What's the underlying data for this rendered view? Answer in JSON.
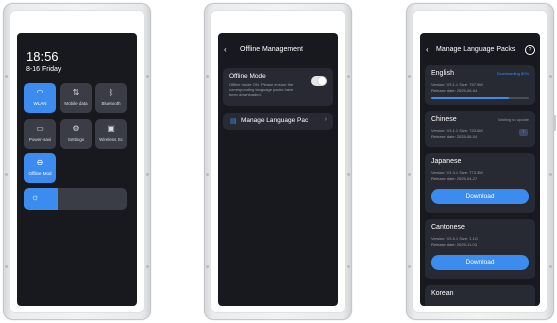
{
  "screen1": {
    "time": "18:56",
    "date": "8-16 Friday",
    "tiles": [
      {
        "label": "WLAN",
        "icon": "wifi-icon",
        "active": true
      },
      {
        "label": "Mobile data",
        "icon": "mobile-data-icon",
        "active": false
      },
      {
        "label": "Bluetooth",
        "icon": "bluetooth-icon",
        "active": false
      },
      {
        "label": "Power-savi",
        "icon": "power-saving-icon",
        "active": false
      },
      {
        "label": "Settings",
        "icon": "settings-icon",
        "active": false
      },
      {
        "label": "Wireless Sc",
        "icon": "wireless-screen-icon",
        "active": false
      },
      {
        "label": "Offline Mod",
        "icon": "offline-mode-icon",
        "active": true
      }
    ],
    "brightness": 0.33
  },
  "screen2": {
    "title": "Offline Management",
    "offline_mode": {
      "label": "Offline Mode",
      "description": "Offline mode ON. Please ensure the corresponding language packs have been downloaded.",
      "enabled": true
    },
    "manage_label": "Manage Language Pac"
  },
  "screen3": {
    "title": "Manage Language Packs",
    "packs": [
      {
        "name": "English",
        "version": "Version: V3.1.1 Size: 757.9M",
        "release": "Release date: 2025-06-04",
        "status": "Downloading 80%",
        "progress": 0.8
      },
      {
        "name": "Chinese",
        "version": "Version: V3.1.1 Size: 723.0M",
        "release": "Release date: 2025-06-04",
        "status": "Waiting to update"
      },
      {
        "name": "Japanese",
        "version": "Version: V1.3.1 Size: 773.3M",
        "release": "Release date: 2025-04-27",
        "button": "Download"
      },
      {
        "name": "Cantonese",
        "version": "Version: V3.5.1 Size: 1.1G",
        "release": "Release date: 2025-11-03",
        "button": "Download"
      },
      {
        "name": "Korean"
      }
    ]
  },
  "colors": {
    "accent": "#3c8cf0",
    "screen_bg": "#17191f",
    "card_bg": "#272a33",
    "tile_bg": "#3a3d46"
  }
}
